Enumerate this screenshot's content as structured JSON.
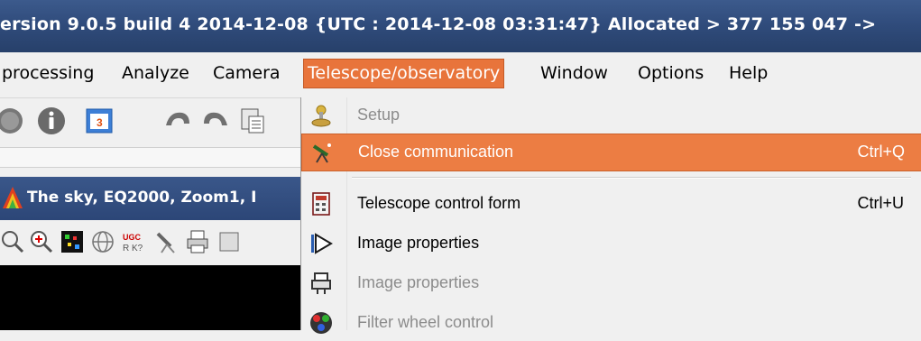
{
  "window": {
    "title": "ersion  9.0.5 build 4   2014-12-08  {UTC : 2014-12-08 03:31:47} Allocated > 377 155 047 ->"
  },
  "menubar": {
    "items": [
      {
        "label": "processing"
      },
      {
        "label": "Analyze"
      },
      {
        "label": "Camera"
      },
      {
        "label": "Telescope/observatory"
      },
      {
        "label": "Window"
      },
      {
        "label": "Options"
      },
      {
        "label": "Help"
      }
    ]
  },
  "image_window": {
    "title": "The sky, EQ2000, Zoom1, I"
  },
  "dropdown": {
    "items": [
      {
        "label": "Setup",
        "shortcut": "",
        "enabled": false,
        "icon": "setup-joystick-icon"
      },
      {
        "label": "Close communication",
        "shortcut": "Ctrl+Q",
        "enabled": true,
        "highlighted": true,
        "icon": "telescope-icon"
      },
      {
        "label": "Telescope control form",
        "shortcut": "Ctrl+U",
        "enabled": true,
        "icon": "control-form-icon"
      },
      {
        "label": "Image properties",
        "shortcut": "",
        "enabled": true,
        "icon": "play-arrow-icon"
      },
      {
        "label": "Image properties",
        "shortcut": "",
        "enabled": false,
        "icon": "mount-icon"
      },
      {
        "label": "Filter wheel control",
        "shortcut": "",
        "enabled": false,
        "icon": "filter-wheel-icon"
      }
    ]
  },
  "colors": {
    "accent": "#ec7d43",
    "titlebar": "#304c7c"
  }
}
